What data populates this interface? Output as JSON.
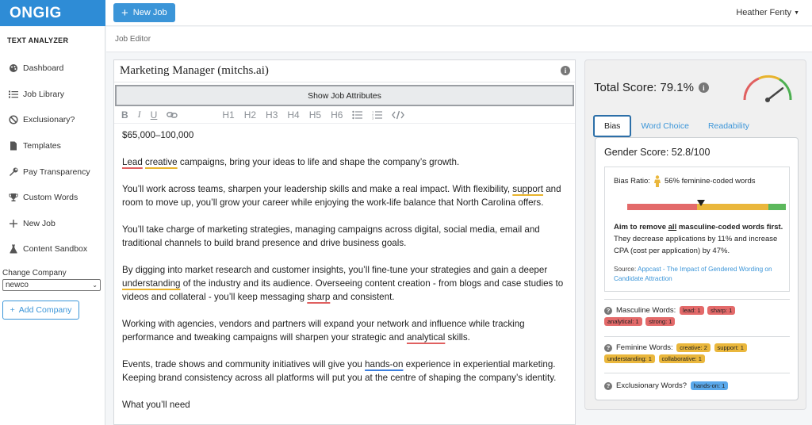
{
  "app": {
    "logo": "ONGIG"
  },
  "topbar": {
    "new_job_label": "New Job",
    "user_name": "Heather Fenty"
  },
  "sidebar": {
    "heading": "TEXT ANALYZER",
    "items": [
      {
        "label": "Dashboard",
        "icon": "palette-icon"
      },
      {
        "label": "Job Library",
        "icon": "list-icon"
      },
      {
        "label": "Exclusionary?",
        "icon": "ban-icon"
      },
      {
        "label": "Templates",
        "icon": "document-icon"
      },
      {
        "label": "Pay Transparency",
        "icon": "wrench-icon"
      },
      {
        "label": "Custom Words",
        "icon": "trophy-icon"
      },
      {
        "label": "New Job",
        "icon": "plus-icon"
      },
      {
        "label": "Content Sandbox",
        "icon": "flask-icon"
      }
    ],
    "change_company_label": "Change Company",
    "company_value": "newco",
    "add_company_label": "Add Company"
  },
  "subheader": {
    "title": "Job Editor"
  },
  "editor": {
    "job_title": "Marketing Manager (mitchs.ai)",
    "show_attributes_label": "Show Job Attributes",
    "toolbar": [
      "B",
      "I",
      "U",
      "link",
      "H1",
      "H2",
      "H3",
      "H4",
      "H5",
      "H6",
      "bullet-list",
      "numbered-list",
      "code"
    ],
    "salary": "$65,000–100,000",
    "p1": {
      "w1": "Lead",
      "w2": "creative",
      "rest": " campaigns, bring your ideas to life and shape the company’s growth."
    },
    "p2": {
      "a": "You’ll work across teams, sharpen your leadership skills and make a real impact. With flexibility, ",
      "w": "support",
      "b": " and room to move up, you’ll grow your career while enjoying the work-life balance that North Carolina offers."
    },
    "p3": "You’ll take charge of marketing strategies, managing campaigns across digital, social media, email and traditional channels to build brand presence and drive business goals.",
    "p4": {
      "a": "By digging into market research and customer insights, you’ll fine-tune your strategies and gain a deeper ",
      "w1": "understanding",
      "b": " of the industry and its audience. Overseeing content creation - from blogs and case studies to videos and collateral - you’ll keep messaging ",
      "w2": "sharp",
      "c": " and consistent."
    },
    "p5": {
      "a": "Working with agencies, vendors and partners will expand your network and influence while tracking performance and tweaking campaigns will sharpen your strategic and ",
      "w": "analytical",
      "b": " skills."
    },
    "p6": {
      "a": "Events, trade shows and community initiatives will give you ",
      "w": "hands-on",
      "b": " experience in experiential marketing. Keeping brand consistency across all platforms will put you at the centre of shaping the company’s identity."
    },
    "p7": "What you’ll need"
  },
  "score": {
    "total_label": "Total Score: 79.1%",
    "total_value": 79.1,
    "tabs": [
      "Bias",
      "Word Choice",
      "Readability"
    ],
    "active_tab": "Bias",
    "gender_score_label": "Gender Score: 52.8/100",
    "bias_ratio_label": "Bias Ratio:",
    "bias_ratio_text": "56% feminine-coded words",
    "feminine_ratio": 0.56,
    "advice_pre": "Aim to remove ",
    "advice_em": "all",
    "advice_bold_rest": " masculine-coded words first.",
    "advice_rest": " They decrease applications by 11% and increase CPA (cost per application) by 47%.",
    "source_label": "Source: ",
    "source_link": "Appcast - The Impact of Gendered Wording on Candidate Attraction",
    "masculine_label": "Masculine Words:",
    "masculine_words": [
      "lead: 1",
      "sharp: 1",
      "analytical: 1",
      "strong: 1"
    ],
    "feminine_label": "Feminine Words:",
    "feminine_words": [
      "creative: 2",
      "support: 1",
      "understanding: 1",
      "collaborative: 1"
    ],
    "exclusionary_label": "Exclusionary Words?",
    "exclusionary_words": [
      "hands-on: 1"
    ],
    "colors": {
      "masculine": "#e36a6a",
      "feminine": "#eab73c",
      "exclusionary": "#5aa8ea",
      "accent": "#3b95d8"
    }
  }
}
